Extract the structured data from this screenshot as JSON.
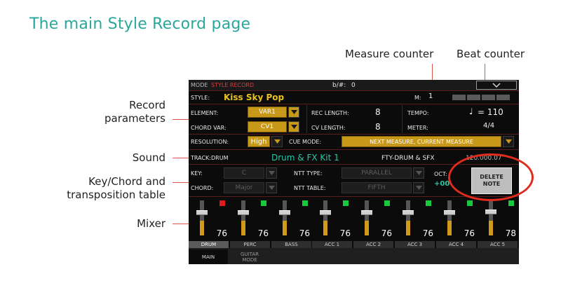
{
  "page": {
    "title": "The main Style Record page"
  },
  "callouts": {
    "measure_counter": "Measure counter",
    "beat_counter": "Beat counter",
    "record_parameters_line1": "Record",
    "record_parameters_line2": "parameters",
    "sound": "Sound",
    "key_chord_line1": "Key/Chord and",
    "key_chord_line2": "transposition table",
    "mixer": "Mixer"
  },
  "screen": {
    "header": {
      "mode_label": "MODE",
      "mode_value": "STYLE RECORD",
      "transpose_label": "b/#:",
      "transpose_value": "0"
    },
    "style": {
      "label": "STYLE:",
      "name": "Kiss Sky Pop",
      "measure_label": "M:",
      "measure_value": "1"
    },
    "element": {
      "label": "ELEMENT:",
      "value": "VAR1"
    },
    "chord_var": {
      "label": "CHORD VAR:",
      "value": "CV1"
    },
    "rec_length": {
      "label": "REC LENGTH:",
      "value": "8"
    },
    "cv_length": {
      "label": "CV LENGTH:",
      "value": "8"
    },
    "tempo": {
      "label": "TEMPO:",
      "value": "= 110"
    },
    "meter": {
      "label": "METER:",
      "value": "4/4"
    },
    "resolution": {
      "label": "RESOLUTION:",
      "value": "High"
    },
    "cue_mode": {
      "label": "CUE MODE:",
      "value": "NEXT MEASURE, CURRENT MEASURE"
    },
    "track": {
      "label": "TRACK:",
      "value": "DRUM",
      "sound_name": "Drum & FX Kit 1",
      "sound_info": "FTY-DRUM & SFX",
      "sound_id": "120.000.07"
    },
    "key": {
      "label": "KEY:",
      "value": "C"
    },
    "chord": {
      "label": "CHORD:",
      "value": "Major"
    },
    "ntt_type": {
      "label": "NTT TYPE:",
      "value": "PARALLEL"
    },
    "ntt_table": {
      "label": "NTT TABLE:",
      "value": "FIFTH"
    },
    "oct": {
      "label": "OCT:",
      "value": "+00"
    },
    "delete_note": {
      "line1": "DELETE",
      "line2": "NOTE"
    },
    "mixer": [
      {
        "name": "DRUM",
        "value": "76",
        "level": 0.76,
        "led": "red"
      },
      {
        "name": "PERC",
        "value": "76",
        "level": 0.76,
        "led": "green"
      },
      {
        "name": "BASS",
        "value": "76",
        "level": 0.76,
        "led": "green"
      },
      {
        "name": "ACC 1",
        "value": "76",
        "level": 0.76,
        "led": "green"
      },
      {
        "name": "ACC 2",
        "value": "76",
        "level": 0.76,
        "led": "green"
      },
      {
        "name": "ACC 3",
        "value": "76",
        "level": 0.76,
        "led": "green"
      },
      {
        "name": "ACC 4",
        "value": "76",
        "level": 0.76,
        "led": "green"
      },
      {
        "name": "ACC 5",
        "value": "78",
        "level": 0.78,
        "led": "green"
      }
    ],
    "tabs": {
      "main": "MAIN",
      "guitar_mode_line1": "GUITAR",
      "guitar_mode_line2": "MODE"
    }
  },
  "colors": {
    "title": "#2aa79b",
    "leader": "#e0534a",
    "screen_bg": "#0b0b0b",
    "accent_yellow": "#e8c21f",
    "accent_red": "#e23b3b",
    "highlight_circle": "#e12b1e"
  }
}
